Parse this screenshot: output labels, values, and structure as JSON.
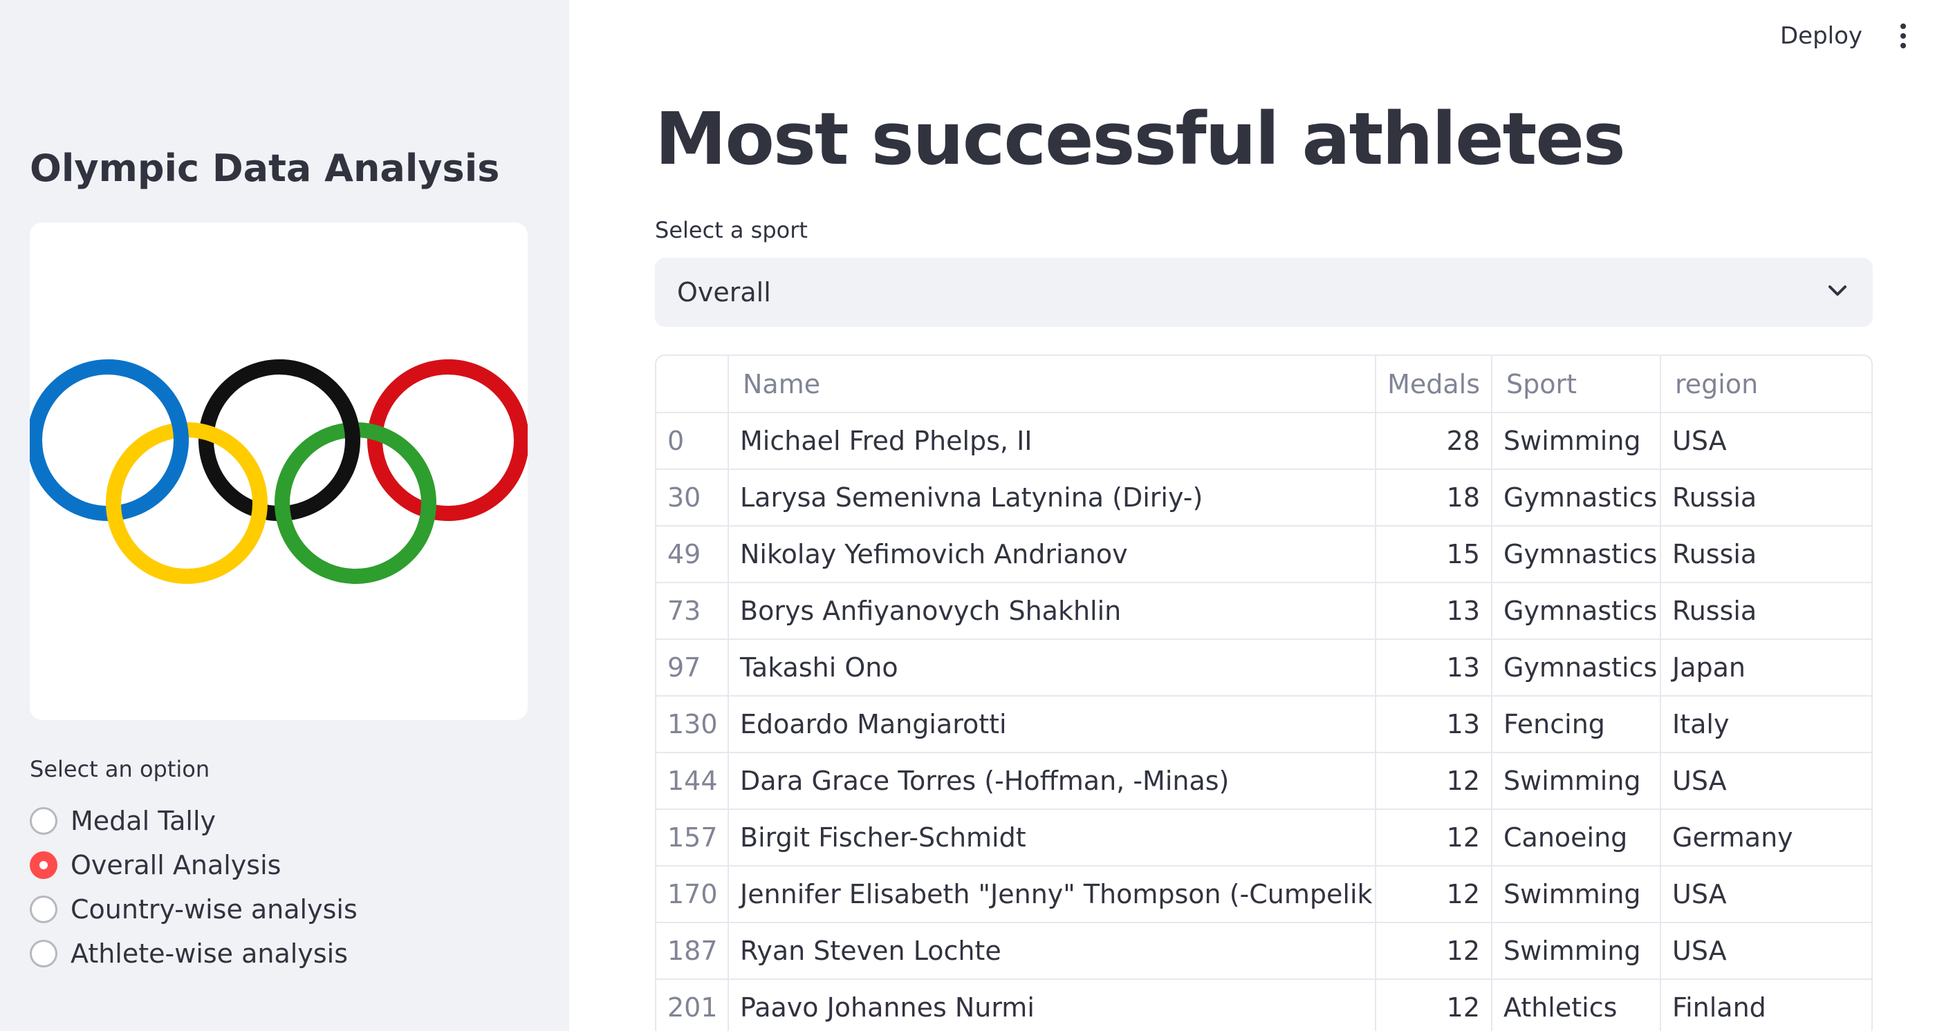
{
  "sidebar": {
    "title": "Olympic Data Analysis",
    "logo": "olympic-rings-logo",
    "radio_label": "Select an option",
    "options": [
      {
        "label": "Medal Tally",
        "selected": false
      },
      {
        "label": "Overall Analysis",
        "selected": true
      },
      {
        "label": "Country-wise analysis",
        "selected": false
      },
      {
        "label": "Athlete-wise analysis",
        "selected": false
      }
    ]
  },
  "header": {
    "deploy_label": "Deploy",
    "menu_icon": "kebab-menu-icon"
  },
  "main": {
    "title": "Most successful athletes",
    "select_label": "Select a sport",
    "select_value": "Overall",
    "table": {
      "columns": [
        "",
        "Name",
        "Medals",
        "Sport",
        "region"
      ],
      "rows": [
        [
          "0",
          "Michael Fred Phelps, II",
          "28",
          "Swimming",
          "USA"
        ],
        [
          "30",
          "Larysa Semenivna Latynina (Diriy-)",
          "18",
          "Gymnastics",
          "Russia"
        ],
        [
          "49",
          "Nikolay Yefimovich Andrianov",
          "15",
          "Gymnastics",
          "Russia"
        ],
        [
          "73",
          "Borys Anfiyanovych Shakhlin",
          "13",
          "Gymnastics",
          "Russia"
        ],
        [
          "97",
          "Takashi Ono",
          "13",
          "Gymnastics",
          "Japan"
        ],
        [
          "130",
          "Edoardo Mangiarotti",
          "13",
          "Fencing",
          "Italy"
        ],
        [
          "144",
          "Dara Grace Torres (-Hoffman, -Minas)",
          "12",
          "Swimming",
          "USA"
        ],
        [
          "157",
          "Birgit Fischer-Schmidt",
          "12",
          "Canoeing",
          "Germany"
        ],
        [
          "170",
          "Jennifer Elisabeth \"Jenny\" Thompson (-Cumpelik)",
          "12",
          "Swimming",
          "USA"
        ],
        [
          "187",
          "Ryan Steven Lochte",
          "12",
          "Swimming",
          "USA"
        ],
        [
          "201",
          "Paavo Johannes Nurmi",
          "12",
          "Athletics",
          "Finland"
        ]
      ]
    }
  },
  "colors": {
    "accent": "#ff4b4b",
    "sidebar_bg": "#f0f2f6",
    "text": "#31333f",
    "ring_blue": "#0081c8",
    "ring_yellow": "#fcb131",
    "ring_black": "#000000",
    "ring_green": "#00a651",
    "ring_red": "#ee334e"
  }
}
